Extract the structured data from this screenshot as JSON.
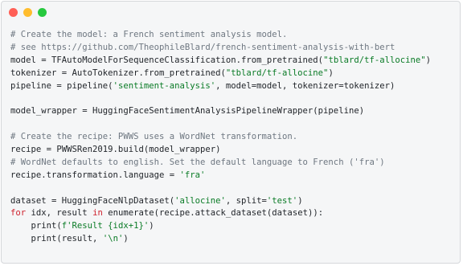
{
  "window": {
    "controls": [
      {
        "name": "close",
        "color": "#ff5f56"
      },
      {
        "name": "minimize",
        "color": "#ffbd2e"
      },
      {
        "name": "zoom",
        "color": "#27c93f"
      }
    ]
  },
  "code": {
    "lines": [
      [
        {
          "t": "c",
          "v": "# Create the model: a French sentiment analysis model."
        }
      ],
      [
        {
          "t": "c",
          "v": "# see https://github.com/TheophileBlard/french-sentiment-analysis-with-bert"
        }
      ],
      [
        {
          "t": "p",
          "v": "model = TFAutoModelForSequenceClassification.from_pretrained("
        },
        {
          "t": "s",
          "v": "\"tblard/tf-allocine\""
        },
        {
          "t": "p",
          "v": ")"
        }
      ],
      [
        {
          "t": "p",
          "v": "tokenizer = AutoTokenizer.from_pretrained("
        },
        {
          "t": "s",
          "v": "\"tblard/tf-allocine\""
        },
        {
          "t": "p",
          "v": ")"
        }
      ],
      [
        {
          "t": "p",
          "v": "pipeline = pipeline("
        },
        {
          "t": "s",
          "v": "'sentiment-analysis'"
        },
        {
          "t": "p",
          "v": ", model=model, tokenizer=tokenizer)"
        }
      ],
      [],
      [
        {
          "t": "p",
          "v": "model_wrapper = HuggingFaceSentimentAnalysisPipelineWrapper(pipeline)"
        }
      ],
      [],
      [
        {
          "t": "c",
          "v": "# Create the recipe: PWWS uses a WordNet transformation."
        }
      ],
      [
        {
          "t": "p",
          "v": "recipe = PWWSRen2019.build(model_wrapper)"
        }
      ],
      [
        {
          "t": "c",
          "v": "# WordNet defaults to english. Set the default language to French ('fra')"
        }
      ],
      [
        {
          "t": "p",
          "v": "recipe.transformation.language = "
        },
        {
          "t": "s",
          "v": "'fra'"
        }
      ],
      [],
      [
        {
          "t": "p",
          "v": "dataset = HuggingFaceNlpDataset("
        },
        {
          "t": "s",
          "v": "'allocine'"
        },
        {
          "t": "p",
          "v": ", split="
        },
        {
          "t": "s",
          "v": "'test'"
        },
        {
          "t": "p",
          "v": ")"
        }
      ],
      [
        {
          "t": "k",
          "v": "for"
        },
        {
          "t": "p",
          "v": " idx, result "
        },
        {
          "t": "k",
          "v": "in"
        },
        {
          "t": "p",
          "v": " enumerate(recipe.attack_dataset(dataset)):"
        }
      ],
      [
        {
          "t": "p",
          "v": "    print("
        },
        {
          "t": "s",
          "v": "f'Result {idx+1}'"
        },
        {
          "t": "p",
          "v": ")"
        }
      ],
      [
        {
          "t": "p",
          "v": "    print(result, "
        },
        {
          "t": "s",
          "v": "'\\n'"
        },
        {
          "t": "p",
          "v": ")"
        }
      ]
    ]
  }
}
